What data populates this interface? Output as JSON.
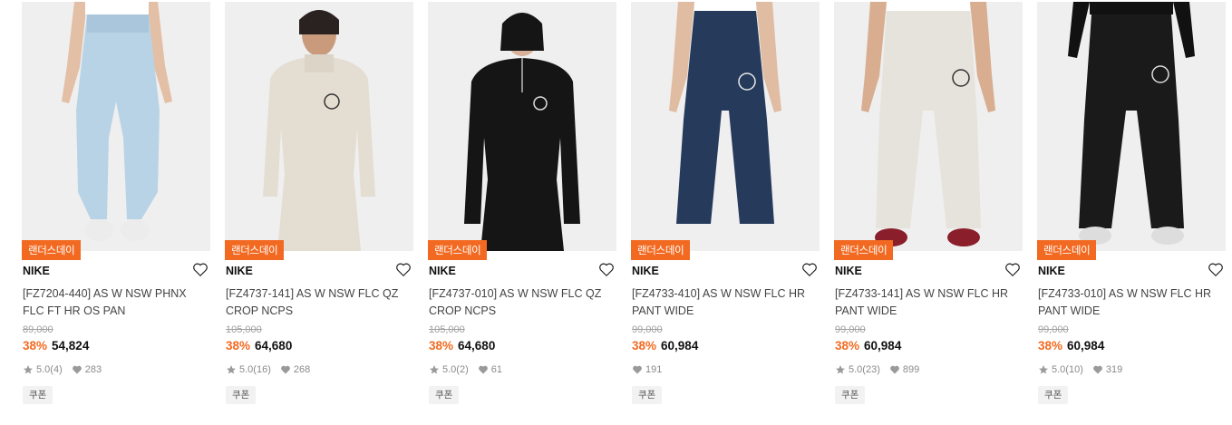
{
  "products": [
    {
      "badge": "랜더스데이",
      "brand": "NIKE",
      "name": "[FZ7204-440] AS W NSW PHNX FLC FT HR OS PAN",
      "original_price": "89,000",
      "discount": "38%",
      "price": "54,824",
      "rating": "5.0",
      "review_count": "(4)",
      "likes": "283",
      "coupon": "쿠폰",
      "colors": {
        "top": "#ffffff",
        "bottom": "#b9d3e6",
        "shoes": "#ececec"
      }
    },
    {
      "badge": "랜더스데이",
      "brand": "NIKE",
      "name": "[FZ4737-141] AS W NSW FLC QZ CROP NCPS",
      "original_price": "105,000",
      "discount": "38%",
      "price": "64,680",
      "rating": "5.0",
      "review_count": "(16)",
      "likes": "268",
      "coupon": "쿠폰",
      "colors": {
        "top": "#e4ddd1",
        "bottom": "#e4ddd1",
        "shoes": "#e4ddd1"
      }
    },
    {
      "badge": "랜더스데이",
      "brand": "NIKE",
      "name": "[FZ4737-010] AS W NSW FLC QZ CROP NCPS",
      "original_price": "105,000",
      "discount": "38%",
      "price": "64,680",
      "rating": "5.0",
      "review_count": "(2)",
      "likes": "61",
      "coupon": "쿠폰",
      "colors": {
        "top": "#151515",
        "bottom": "#151515",
        "shoes": "#151515"
      }
    },
    {
      "badge": "랜더스데이",
      "brand": "NIKE",
      "name": "[FZ4733-410] AS W NSW FLC HR PANT WIDE",
      "original_price": "99,000",
      "discount": "38%",
      "price": "60,984",
      "rating": "",
      "review_count": "",
      "likes": "191",
      "coupon": "쿠폰",
      "colors": {
        "top": "#ffffff",
        "bottom": "#263a5c",
        "shoes": "#efefef"
      }
    },
    {
      "badge": "랜더스데이",
      "brand": "NIKE",
      "name": "[FZ4733-141] AS W NSW FLC HR PANT WIDE",
      "original_price": "99,000",
      "discount": "38%",
      "price": "60,984",
      "rating": "5.0",
      "review_count": "(23)",
      "likes": "899",
      "coupon": "쿠폰",
      "colors": {
        "top": "#ffffff",
        "bottom": "#e6e3dc",
        "shoes": "#8a1e2a"
      }
    },
    {
      "badge": "랜더스데이",
      "brand": "NIKE",
      "name": "[FZ4733-010] AS W NSW FLC HR PANT WIDE",
      "original_price": "99,000",
      "discount": "38%",
      "price": "60,984",
      "rating": "5.0",
      "review_count": "(10)",
      "likes": "319",
      "coupon": "쿠폰",
      "colors": {
        "top": "#111111",
        "bottom": "#1a1a1a",
        "shoes": "#dddddd"
      }
    }
  ],
  "icons": {
    "wishlist": "heart-outline-icon",
    "rating": "star-icon",
    "likes": "heart-filled-icon"
  },
  "theme": {
    "accent": "#f26a21",
    "muted": "#8a8a8a",
    "strike": "#a0a0a0"
  }
}
